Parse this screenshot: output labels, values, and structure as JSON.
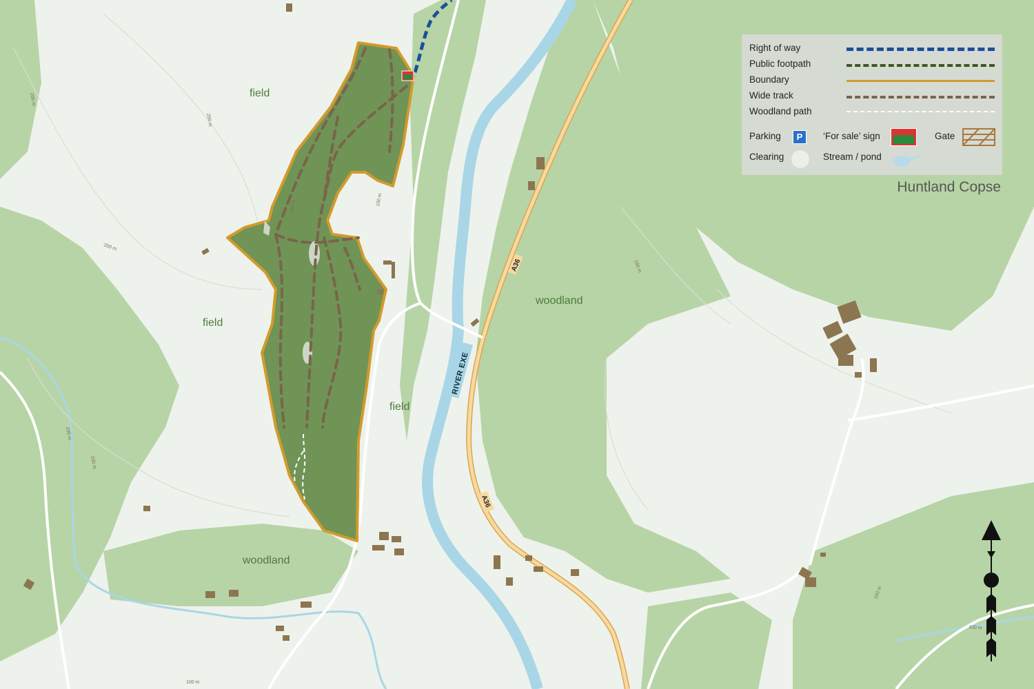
{
  "title": "Huntland Copse",
  "colors": {
    "background": "#eef2ec",
    "woodland": "#b7d4a6",
    "property_fill": "#6f9456",
    "boundary": "#d39a2c",
    "right_of_way": "#1d4f9a",
    "public_footpath": "#3a5a1e",
    "wide_track": "#7a644a",
    "woodland_path": "#ffffff",
    "river": "#a9d6e6",
    "road_a36": "#f2c879",
    "building": "#8c7650"
  },
  "legend": {
    "right_of_way": "Right of way",
    "public_footpath": "Public footpath",
    "boundary": "Boundary",
    "wide_track": "Wide track",
    "woodland_path": "Woodland path",
    "parking": "Parking",
    "parking_glyph": "P",
    "for_sale_sign": "‘For sale’ sign",
    "gate": "Gate",
    "clearing": "Clearing",
    "stream_pond": "Stream / pond"
  },
  "map_labels": {
    "field_1": "field",
    "field_2": "field",
    "field_3": "field",
    "woodland_1": "woodland",
    "woodland_2": "woodland",
    "river": "RIVER EXE",
    "road_1": "A36",
    "road_2": "A36"
  },
  "contours": {
    "c1": "200 m",
    "c2": "200 m",
    "c3": "200 m",
    "c4": "150 m",
    "c5": "100 m",
    "c6": "100 m",
    "c7": "150 m",
    "c8": "150 m",
    "c9": "100 m",
    "c10": "100 m",
    "c11": "100 m"
  },
  "icons": {
    "compass": "north-arrow-icon",
    "sign": "for-sale-sign-icon",
    "gate": "gate-icon",
    "parking": "parking-icon",
    "clearing": "clearing-icon",
    "stream": "stream-pond-icon"
  }
}
